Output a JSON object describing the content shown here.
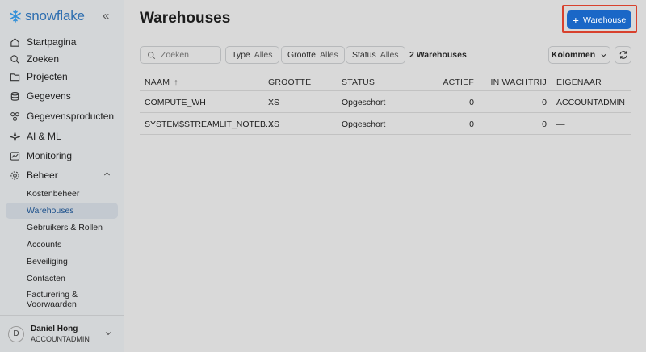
{
  "sidebar": {
    "logo": "snowflake",
    "items": [
      {
        "label": "Startpagina",
        "icon": "home-icon"
      },
      {
        "label": "Zoeken",
        "icon": "search-icon"
      },
      {
        "label": "Projecten",
        "icon": "folder-icon"
      },
      {
        "label": "Gegevens",
        "icon": "database-icon"
      },
      {
        "label": "Gegevensproducten",
        "icon": "products-icon"
      },
      {
        "label": "AI & ML",
        "icon": "ai-icon"
      },
      {
        "label": "Monitoring",
        "icon": "monitoring-icon"
      },
      {
        "label": "Beheer",
        "icon": "gear-icon"
      }
    ],
    "sub_items": [
      "Kostenbeheer",
      "Warehouses",
      "Gebruikers & Rollen",
      "Accounts",
      "Beveiliging",
      "Contacten",
      "Facturering & Voorwaarden"
    ],
    "user": {
      "initial": "D",
      "name": "Daniel Hong",
      "role": "ACCOUNTADMIN"
    }
  },
  "header": {
    "title": "Warehouses",
    "add_button": "Warehouse"
  },
  "toolbar": {
    "search_placeholder": "Zoeken",
    "filters": [
      {
        "label": "Type",
        "value": "Alles"
      },
      {
        "label": "Grootte",
        "value": "Alles"
      },
      {
        "label": "Status",
        "value": "Alles"
      }
    ],
    "count": "2 Warehouses",
    "columns_button": "Kolommen"
  },
  "table": {
    "headers": [
      "NAAM",
      "GROOTTE",
      "STATUS",
      "ACTIEF",
      "IN WACHTRIJ",
      "EIGENAAR"
    ],
    "sort_indicator": "↑",
    "rows": [
      [
        "COMPUTE_WH",
        "XS",
        "Opgeschort",
        "0",
        "0",
        "ACCOUNTADMIN"
      ],
      [
        "SYSTEM$STREAMLIT_NOTEB...",
        "XS",
        "Opgeschort",
        "0",
        "0",
        "—"
      ]
    ]
  },
  "colors": {
    "accent": "#1a67c7",
    "highlight": "#d8412d",
    "sidebar_bg": "#d3d6d8",
    "main_bg": "#d9d9d9"
  }
}
